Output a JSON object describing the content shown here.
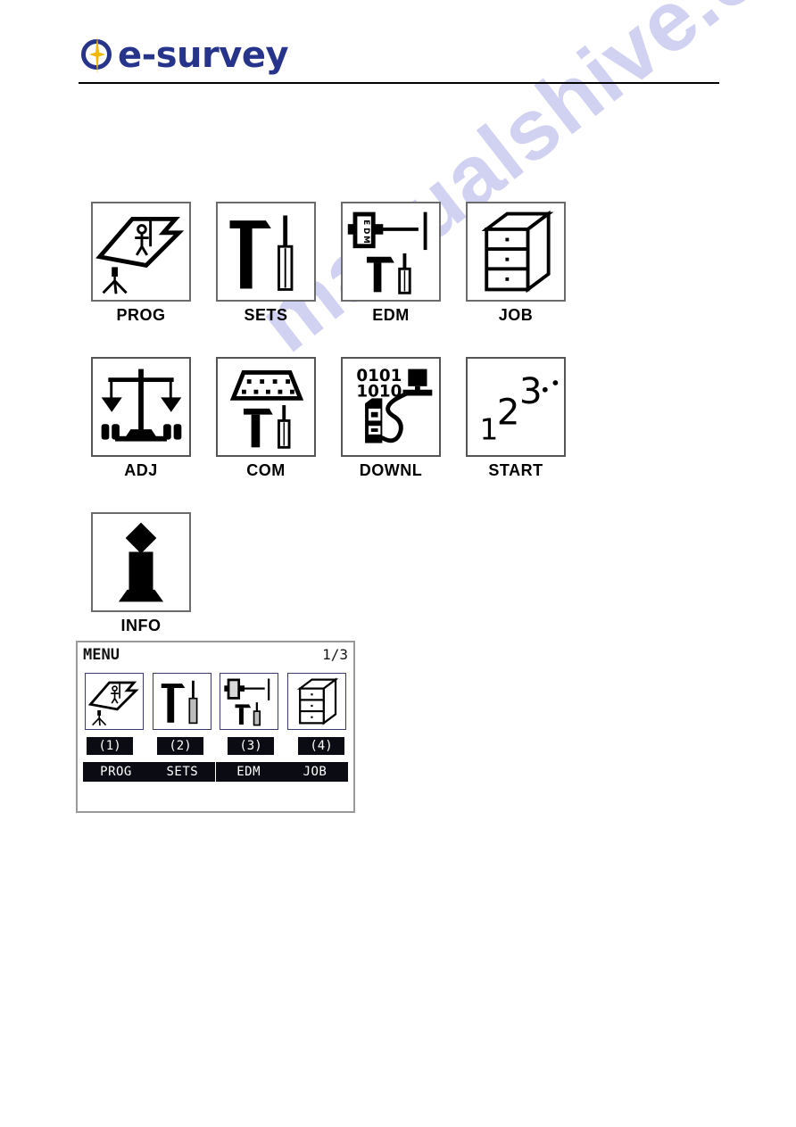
{
  "brand": {
    "logo_text": "e-survey",
    "logo_mark_icon": "compass-star-icon",
    "primary_color": "#26348c",
    "accent_color": "#f2b705"
  },
  "icon_grid": {
    "rows": [
      [
        {
          "label": "PROG",
          "icon": "survey-field-prog-icon"
        },
        {
          "label": "SETS",
          "icon": "hammer-screwdriver-sets-icon"
        },
        {
          "label": "EDM",
          "icon": "edm-beam-tools-icon"
        },
        {
          "label": "JOB",
          "icon": "file-cabinet-job-icon"
        }
      ],
      [
        {
          "label": "ADJ",
          "icon": "balance-scale-adj-icon"
        },
        {
          "label": "COM",
          "icon": "connector-port-com-icon"
        },
        {
          "label": "DOWNL",
          "icon": "download-cable-computer-icon"
        },
        {
          "label": "START",
          "icon": "numbers-sequence-start-icon"
        }
      ],
      [
        {
          "label": "INFO",
          "icon": "information-i-icon"
        }
      ]
    ]
  },
  "lcd": {
    "title": "MENU",
    "page_indicator": "1/3",
    "icons": [
      {
        "icon": "survey-field-prog-icon"
      },
      {
        "icon": "hammer-screwdriver-sets-icon"
      },
      {
        "icon": "edm-beam-tools-icon"
      },
      {
        "icon": "file-cabinet-job-icon"
      }
    ],
    "number_badges": [
      "(1)",
      "(2)",
      "(3)",
      "(4)"
    ],
    "soft_keys": [
      "PROG",
      "SETS",
      "EDM",
      "JOB"
    ]
  },
  "watermark": {
    "text": "manualshive.com",
    "color": "#c9c9ef"
  },
  "download_icon": {
    "binary_top": "0101",
    "binary_bottom": "1010"
  },
  "edm_icon": {
    "label": "EDM"
  },
  "start_icon": {
    "digits": [
      "1",
      "2",
      "3"
    ]
  }
}
